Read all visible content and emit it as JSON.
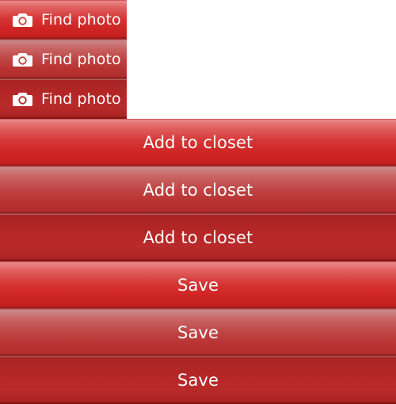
{
  "photo_buttons": [
    {
      "label": "Find photo",
      "icon": "camera-icon",
      "state": "normal"
    },
    {
      "label": "Find photo",
      "icon": "camera-icon",
      "state": "hover"
    },
    {
      "label": "Find photo",
      "icon": "camera-icon",
      "state": "active"
    }
  ],
  "closet_buttons": [
    {
      "label": "Add to closet",
      "state": "normal"
    },
    {
      "label": "Add to closet",
      "state": "hover"
    },
    {
      "label": "Add to closet",
      "state": "active"
    }
  ],
  "save_buttons": [
    {
      "label": "Save",
      "state": "normal"
    },
    {
      "label": "Save",
      "state": "hover"
    },
    {
      "label": "Save",
      "state": "active"
    }
  ],
  "colors": {
    "brand_red": "#d63737",
    "text": "#ffffff",
    "background": "#ffffff"
  }
}
